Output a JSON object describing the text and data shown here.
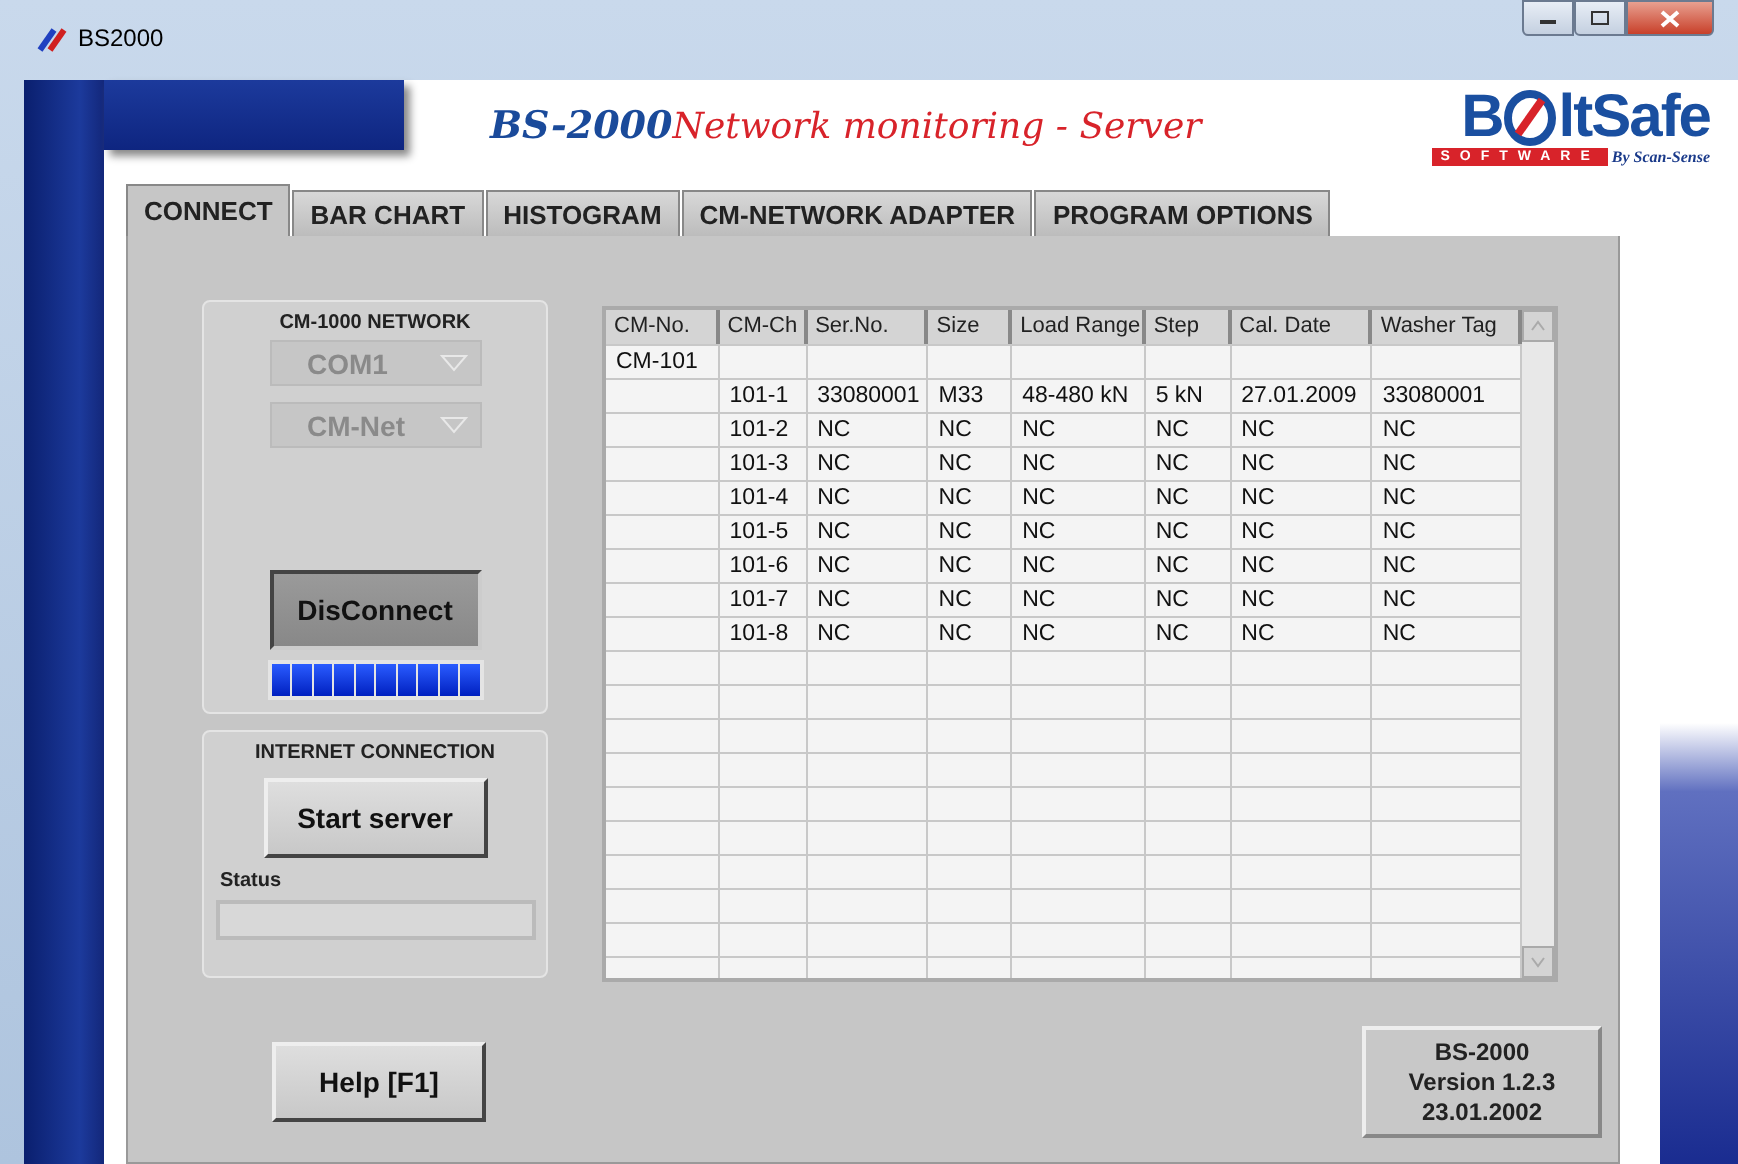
{
  "window": {
    "title": "BS2000"
  },
  "header": {
    "product": "BS-2000",
    "title": "Network monitoring - Server",
    "logo_start": "B",
    "logo_end": "ltSafe",
    "logo_tagline": "SOFTWARE",
    "logo_by": "By Scan-Sense"
  },
  "tabs": [
    {
      "label": "CONNECT",
      "selected": true
    },
    {
      "label": "BAR CHART",
      "selected": false
    },
    {
      "label": "HISTOGRAM",
      "selected": false
    },
    {
      "label": "CM-NETWORK ADAPTER",
      "selected": false
    },
    {
      "label": "PROGRAM OPTIONS",
      "selected": false
    }
  ],
  "network": {
    "title": "CM-1000 NETWORK",
    "dropdowns": [
      {
        "value": "COM1",
        "disabled": true
      },
      {
        "value": "CM-Net",
        "disabled": true
      }
    ],
    "button": {
      "label": "DisConnect",
      "pressed": true
    },
    "progress": {
      "level": 1
    }
  },
  "internet": {
    "title": "INTERNET CONNECTION",
    "button": {
      "label": "Start server",
      "pressed": false
    },
    "status_label": "Status"
  },
  "table": {
    "columns": [
      "CM-No.",
      "CM-Ch",
      "Ser.No.",
      "Size",
      "Load Range",
      "Step",
      "Cal. Date",
      "Washer Tag"
    ],
    "rows": [
      [
        "CM-101",
        null,
        null,
        null,
        null,
        null,
        null,
        null
      ],
      [
        null,
        "101-1",
        "33080001",
        "M33",
        "48-480 kN",
        "5 kN",
        "27.01.2009",
        "33080001"
      ],
      [
        null,
        "101-2",
        "NC",
        "NC",
        "NC",
        "NC",
        "NC",
        "NC"
      ],
      [
        null,
        "101-3",
        "NC",
        "NC",
        "NC",
        "NC",
        "NC",
        "NC"
      ],
      [
        null,
        "101-4",
        "NC",
        "NC",
        "NC",
        "NC",
        "NC",
        "NC"
      ],
      [
        null,
        "101-5",
        "NC",
        "NC",
        "NC",
        "NC",
        "NC",
        "NC"
      ],
      [
        null,
        "101-6",
        "NC",
        "NC",
        "NC",
        "NC",
        "NC",
        "NC"
      ],
      [
        null,
        "101-7",
        "NC",
        "NC",
        "NC",
        "NC",
        "NC",
        "NC"
      ],
      [
        null,
        "101-8",
        "NC",
        "NC",
        "NC",
        "NC",
        "NC",
        "NC"
      ]
    ]
  },
  "help_button": "Help [F1]",
  "version": [
    "BS-2000",
    "Version 1.2.3",
    "23.01.2002"
  ]
}
